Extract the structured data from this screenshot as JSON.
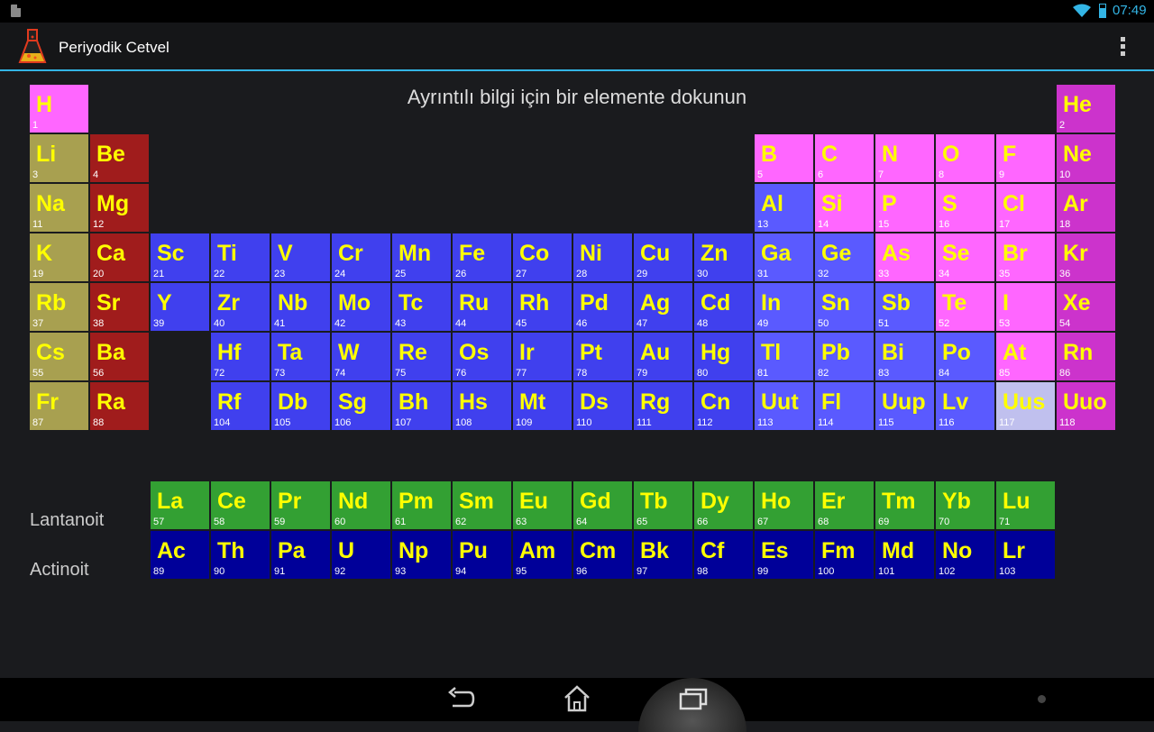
{
  "status": {
    "time": "07:49"
  },
  "app": {
    "title": "Periyodik Cetvel",
    "icon": "flask-logo-icon"
  },
  "hint": "Ayrıntılı bilgi için bir elemente dokunun",
  "row_labels": {
    "lanthanoid": "Lantanoit",
    "actinoid": "Actinoit"
  },
  "colors": {
    "background": "#1a1b1e",
    "accent": "#33b5e5",
    "symbol": "#ffff00",
    "nonmetal": "#ff66ff",
    "noble_gas": "#cc33cc",
    "alkali": "#a8a050",
    "alkaline_earth": "#a01c1c",
    "metal": "#4040ee",
    "metal_light": "#5a5aff",
    "lanthanoid": "#33a033",
    "actinoid": "#000099",
    "unknown": "#c0c0ee"
  },
  "elements": [
    {
      "s": "H",
      "n": 1,
      "c": "nonmetal",
      "r": 1,
      "g": 1
    },
    {
      "s": "He",
      "n": 2,
      "c": "noble_gas",
      "r": 1,
      "g": 18
    },
    {
      "s": "Li",
      "n": 3,
      "c": "alkali",
      "r": 2,
      "g": 1
    },
    {
      "s": "Be",
      "n": 4,
      "c": "alkaline_earth",
      "r": 2,
      "g": 2
    },
    {
      "s": "B",
      "n": 5,
      "c": "nonmetal",
      "r": 2,
      "g": 13
    },
    {
      "s": "C",
      "n": 6,
      "c": "nonmetal",
      "r": 2,
      "g": 14
    },
    {
      "s": "N",
      "n": 7,
      "c": "nonmetal",
      "r": 2,
      "g": 15
    },
    {
      "s": "O",
      "n": 8,
      "c": "nonmetal",
      "r": 2,
      "g": 16
    },
    {
      "s": "F",
      "n": 9,
      "c": "nonmetal",
      "r": 2,
      "g": 17
    },
    {
      "s": "Ne",
      "n": 10,
      "c": "noble_gas",
      "r": 2,
      "g": 18
    },
    {
      "s": "Na",
      "n": 11,
      "c": "alkali",
      "r": 3,
      "g": 1
    },
    {
      "s": "Mg",
      "n": 12,
      "c": "alkaline_earth",
      "r": 3,
      "g": 2
    },
    {
      "s": "Al",
      "n": 13,
      "c": "metal_light",
      "r": 3,
      "g": 13
    },
    {
      "s": "Si",
      "n": 14,
      "c": "nonmetal",
      "r": 3,
      "g": 14
    },
    {
      "s": "P",
      "n": 15,
      "c": "nonmetal",
      "r": 3,
      "g": 15
    },
    {
      "s": "S",
      "n": 16,
      "c": "nonmetal",
      "r": 3,
      "g": 16
    },
    {
      "s": "Cl",
      "n": 17,
      "c": "nonmetal",
      "r": 3,
      "g": 17
    },
    {
      "s": "Ar",
      "n": 18,
      "c": "noble_gas",
      "r": 3,
      "g": 18
    },
    {
      "s": "K",
      "n": 19,
      "c": "alkali",
      "r": 4,
      "g": 1
    },
    {
      "s": "Ca",
      "n": 20,
      "c": "alkaline_earth",
      "r": 4,
      "g": 2
    },
    {
      "s": "Sc",
      "n": 21,
      "c": "metal",
      "r": 4,
      "g": 3
    },
    {
      "s": "Ti",
      "n": 22,
      "c": "metal",
      "r": 4,
      "g": 4
    },
    {
      "s": "V",
      "n": 23,
      "c": "metal",
      "r": 4,
      "g": 5
    },
    {
      "s": "Cr",
      "n": 24,
      "c": "metal",
      "r": 4,
      "g": 6
    },
    {
      "s": "Mn",
      "n": 25,
      "c": "metal",
      "r": 4,
      "g": 7
    },
    {
      "s": "Fe",
      "n": 26,
      "c": "metal",
      "r": 4,
      "g": 8
    },
    {
      "s": "Co",
      "n": 27,
      "c": "metal",
      "r": 4,
      "g": 9
    },
    {
      "s": "Ni",
      "n": 28,
      "c": "metal",
      "r": 4,
      "g": 10
    },
    {
      "s": "Cu",
      "n": 29,
      "c": "metal",
      "r": 4,
      "g": 11
    },
    {
      "s": "Zn",
      "n": 30,
      "c": "metal",
      "r": 4,
      "g": 12
    },
    {
      "s": "Ga",
      "n": 31,
      "c": "metal_light",
      "r": 4,
      "g": 13
    },
    {
      "s": "Ge",
      "n": 32,
      "c": "metal_light",
      "r": 4,
      "g": 14
    },
    {
      "s": "As",
      "n": 33,
      "c": "nonmetal",
      "r": 4,
      "g": 15
    },
    {
      "s": "Se",
      "n": 34,
      "c": "nonmetal",
      "r": 4,
      "g": 16
    },
    {
      "s": "Br",
      "n": 35,
      "c": "nonmetal",
      "r": 4,
      "g": 17
    },
    {
      "s": "Kr",
      "n": 36,
      "c": "noble_gas",
      "r": 4,
      "g": 18
    },
    {
      "s": "Rb",
      "n": 37,
      "c": "alkali",
      "r": 5,
      "g": 1
    },
    {
      "s": "Sr",
      "n": 38,
      "c": "alkaline_earth",
      "r": 5,
      "g": 2
    },
    {
      "s": "Y",
      "n": 39,
      "c": "metal",
      "r": 5,
      "g": 3
    },
    {
      "s": "Zr",
      "n": 40,
      "c": "metal",
      "r": 5,
      "g": 4
    },
    {
      "s": "Nb",
      "n": 41,
      "c": "metal",
      "r": 5,
      "g": 5
    },
    {
      "s": "Mo",
      "n": 42,
      "c": "metal",
      "r": 5,
      "g": 6
    },
    {
      "s": "Tc",
      "n": 43,
      "c": "metal",
      "r": 5,
      "g": 7
    },
    {
      "s": "Ru",
      "n": 44,
      "c": "metal",
      "r": 5,
      "g": 8
    },
    {
      "s": "Rh",
      "n": 45,
      "c": "metal",
      "r": 5,
      "g": 9
    },
    {
      "s": "Pd",
      "n": 46,
      "c": "metal",
      "r": 5,
      "g": 10
    },
    {
      "s": "Ag",
      "n": 47,
      "c": "metal",
      "r": 5,
      "g": 11
    },
    {
      "s": "Cd",
      "n": 48,
      "c": "metal",
      "r": 5,
      "g": 12
    },
    {
      "s": "In",
      "n": 49,
      "c": "metal_light",
      "r": 5,
      "g": 13
    },
    {
      "s": "Sn",
      "n": 50,
      "c": "metal_light",
      "r": 5,
      "g": 14
    },
    {
      "s": "Sb",
      "n": 51,
      "c": "metal_light",
      "r": 5,
      "g": 15
    },
    {
      "s": "Te",
      "n": 52,
      "c": "nonmetal",
      "r": 5,
      "g": 16
    },
    {
      "s": "I",
      "n": 53,
      "c": "nonmetal",
      "r": 5,
      "g": 17
    },
    {
      "s": "Xe",
      "n": 54,
      "c": "noble_gas",
      "r": 5,
      "g": 18
    },
    {
      "s": "Cs",
      "n": 55,
      "c": "alkali",
      "r": 6,
      "g": 1
    },
    {
      "s": "Ba",
      "n": 56,
      "c": "alkaline_earth",
      "r": 6,
      "g": 2
    },
    {
      "s": "Hf",
      "n": 72,
      "c": "metal",
      "r": 6,
      "g": 4
    },
    {
      "s": "Ta",
      "n": 73,
      "c": "metal",
      "r": 6,
      "g": 5
    },
    {
      "s": "W",
      "n": 74,
      "c": "metal",
      "r": 6,
      "g": 6
    },
    {
      "s": "Re",
      "n": 75,
      "c": "metal",
      "r": 6,
      "g": 7
    },
    {
      "s": "Os",
      "n": 76,
      "c": "metal",
      "r": 6,
      "g": 8
    },
    {
      "s": "Ir",
      "n": 77,
      "c": "metal",
      "r": 6,
      "g": 9
    },
    {
      "s": "Pt",
      "n": 78,
      "c": "metal",
      "r": 6,
      "g": 10
    },
    {
      "s": "Au",
      "n": 79,
      "c": "metal",
      "r": 6,
      "g": 11
    },
    {
      "s": "Hg",
      "n": 80,
      "c": "metal",
      "r": 6,
      "g": 12
    },
    {
      "s": "Tl",
      "n": 81,
      "c": "metal_light",
      "r": 6,
      "g": 13
    },
    {
      "s": "Pb",
      "n": 82,
      "c": "metal_light",
      "r": 6,
      "g": 14
    },
    {
      "s": "Bi",
      "n": 83,
      "c": "metal_light",
      "r": 6,
      "g": 15
    },
    {
      "s": "Po",
      "n": 84,
      "c": "metal_light",
      "r": 6,
      "g": 16
    },
    {
      "s": "At",
      "n": 85,
      "c": "nonmetal",
      "r": 6,
      "g": 17
    },
    {
      "s": "Rn",
      "n": 86,
      "c": "noble_gas",
      "r": 6,
      "g": 18
    },
    {
      "s": "Fr",
      "n": 87,
      "c": "alkali",
      "r": 7,
      "g": 1
    },
    {
      "s": "Ra",
      "n": 88,
      "c": "alkaline_earth",
      "r": 7,
      "g": 2
    },
    {
      "s": "Rf",
      "n": 104,
      "c": "metal",
      "r": 7,
      "g": 4
    },
    {
      "s": "Db",
      "n": 105,
      "c": "metal",
      "r": 7,
      "g": 5
    },
    {
      "s": "Sg",
      "n": 106,
      "c": "metal",
      "r": 7,
      "g": 6
    },
    {
      "s": "Bh",
      "n": 107,
      "c": "metal",
      "r": 7,
      "g": 7
    },
    {
      "s": "Hs",
      "n": 108,
      "c": "metal",
      "r": 7,
      "g": 8
    },
    {
      "s": "Mt",
      "n": 109,
      "c": "metal",
      "r": 7,
      "g": 9
    },
    {
      "s": "Ds",
      "n": 110,
      "c": "metal",
      "r": 7,
      "g": 10
    },
    {
      "s": "Rg",
      "n": 111,
      "c": "metal",
      "r": 7,
      "g": 11
    },
    {
      "s": "Cn",
      "n": 112,
      "c": "metal",
      "r": 7,
      "g": 12
    },
    {
      "s": "Uut",
      "n": 113,
      "c": "metal_light",
      "r": 7,
      "g": 13
    },
    {
      "s": "Fl",
      "n": 114,
      "c": "metal_light",
      "r": 7,
      "g": 14
    },
    {
      "s": "Uup",
      "n": 115,
      "c": "metal_light",
      "r": 7,
      "g": 15
    },
    {
      "s": "Lv",
      "n": 116,
      "c": "metal_light",
      "r": 7,
      "g": 16
    },
    {
      "s": "Uus",
      "n": 117,
      "c": "unknown",
      "r": 7,
      "g": 17
    },
    {
      "s": "Uuo",
      "n": 118,
      "c": "noble_gas",
      "r": 7,
      "g": 18
    },
    {
      "s": "La",
      "n": 57,
      "c": "lanthanoid",
      "r": 9,
      "g": 3
    },
    {
      "s": "Ce",
      "n": 58,
      "c": "lanthanoid",
      "r": 9,
      "g": 4
    },
    {
      "s": "Pr",
      "n": 59,
      "c": "lanthanoid",
      "r": 9,
      "g": 5
    },
    {
      "s": "Nd",
      "n": 60,
      "c": "lanthanoid",
      "r": 9,
      "g": 6
    },
    {
      "s": "Pm",
      "n": 61,
      "c": "lanthanoid",
      "r": 9,
      "g": 7
    },
    {
      "s": "Sm",
      "n": 62,
      "c": "lanthanoid",
      "r": 9,
      "g": 8
    },
    {
      "s": "Eu",
      "n": 63,
      "c": "lanthanoid",
      "r": 9,
      "g": 9
    },
    {
      "s": "Gd",
      "n": 64,
      "c": "lanthanoid",
      "r": 9,
      "g": 10
    },
    {
      "s": "Tb",
      "n": 65,
      "c": "lanthanoid",
      "r": 9,
      "g": 11
    },
    {
      "s": "Dy",
      "n": 66,
      "c": "lanthanoid",
      "r": 9,
      "g": 12
    },
    {
      "s": "Ho",
      "n": 67,
      "c": "lanthanoid",
      "r": 9,
      "g": 13
    },
    {
      "s": "Er",
      "n": 68,
      "c": "lanthanoid",
      "r": 9,
      "g": 14
    },
    {
      "s": "Tm",
      "n": 69,
      "c": "lanthanoid",
      "r": 9,
      "g": 15
    },
    {
      "s": "Yb",
      "n": 70,
      "c": "lanthanoid",
      "r": 9,
      "g": 16
    },
    {
      "s": "Lu",
      "n": 71,
      "c": "lanthanoid",
      "r": 9,
      "g": 17
    },
    {
      "s": "Ac",
      "n": 89,
      "c": "actinoid",
      "r": 10,
      "g": 3
    },
    {
      "s": "Th",
      "n": 90,
      "c": "actinoid",
      "r": 10,
      "g": 4
    },
    {
      "s": "Pa",
      "n": 91,
      "c": "actinoid",
      "r": 10,
      "g": 5
    },
    {
      "s": "U",
      "n": 92,
      "c": "actinoid",
      "r": 10,
      "g": 6
    },
    {
      "s": "Np",
      "n": 93,
      "c": "actinoid",
      "r": 10,
      "g": 7
    },
    {
      "s": "Pu",
      "n": 94,
      "c": "actinoid",
      "r": 10,
      "g": 8
    },
    {
      "s": "Am",
      "n": 95,
      "c": "actinoid",
      "r": 10,
      "g": 9
    },
    {
      "s": "Cm",
      "n": 96,
      "c": "actinoid",
      "r": 10,
      "g": 10
    },
    {
      "s": "Bk",
      "n": 97,
      "c": "actinoid",
      "r": 10,
      "g": 11
    },
    {
      "s": "Cf",
      "n": 98,
      "c": "actinoid",
      "r": 10,
      "g": 12
    },
    {
      "s": "Es",
      "n": 99,
      "c": "actinoid",
      "r": 10,
      "g": 13
    },
    {
      "s": "Fm",
      "n": 100,
      "c": "actinoid",
      "r": 10,
      "g": 14
    },
    {
      "s": "Md",
      "n": 101,
      "c": "actinoid",
      "r": 10,
      "g": 15
    },
    {
      "s": "No",
      "n": 102,
      "c": "actinoid",
      "r": 10,
      "g": 16
    },
    {
      "s": "Lr",
      "n": 103,
      "c": "actinoid",
      "r": 10,
      "g": 17
    }
  ],
  "navbar": {
    "back": "back-icon",
    "home": "home-icon",
    "recents": "recents-icon",
    "menu": "menu-dot-icon"
  }
}
